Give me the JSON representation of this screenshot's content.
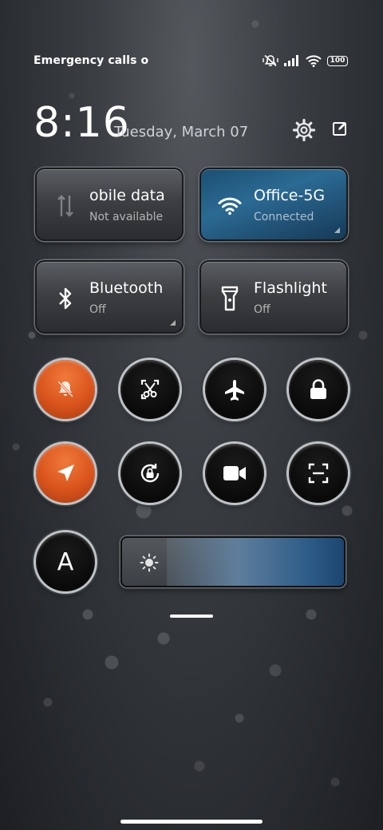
{
  "status": {
    "left_text": "Emergency calls o",
    "battery": "100",
    "icons": [
      "mute-vibrate-icon",
      "signal-icon",
      "wifi-icon",
      "battery-icon"
    ]
  },
  "header": {
    "time": "8:16",
    "date": "Tuesday, March 07",
    "icons": [
      "settings-gear-icon",
      "edit-icon"
    ]
  },
  "tiles": {
    "mobile": {
      "title": "obile data",
      "subtitle": "Not available",
      "icon": "mobile-data-icon"
    },
    "wifi": {
      "title": "Office-5G",
      "subtitle": "Connected",
      "icon": "wifi-icon"
    },
    "bluetooth": {
      "title": "Bluetooth",
      "subtitle": "Off",
      "icon": "bluetooth-icon"
    },
    "flashlight": {
      "title": "Flashlight",
      "subtitle": "Off",
      "icon": "flashlight-icon"
    }
  },
  "toggles": [
    {
      "name": "silent",
      "icon": "bell-off-icon",
      "active": true
    },
    {
      "name": "screenshot",
      "icon": "screenshot-icon",
      "active": false
    },
    {
      "name": "airplane",
      "icon": "airplane-icon",
      "active": false
    },
    {
      "name": "lock",
      "icon": "lock-icon",
      "active": false
    },
    {
      "name": "location",
      "icon": "location-arrow-icon",
      "active": true
    },
    {
      "name": "rotation-lock",
      "icon": "rotation-lock-icon",
      "active": false
    },
    {
      "name": "screen-record",
      "icon": "video-camera-icon",
      "active": false
    },
    {
      "name": "scanner",
      "icon": "scan-icon",
      "active": false
    },
    {
      "name": "auto-brightness",
      "icon": "letter-a-icon",
      "label": "A",
      "active": false
    }
  ],
  "brightness": {
    "level": 0.8,
    "icon": "sun-icon"
  },
  "colors": {
    "active_orange": "#d9541c",
    "active_blue": "#2b6a93"
  }
}
